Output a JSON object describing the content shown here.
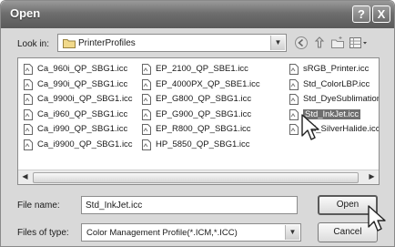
{
  "window": {
    "title": "Open"
  },
  "titlebar_buttons": {
    "help": "?",
    "close": "X"
  },
  "lookin": {
    "label": "Look in:",
    "value": "PrinterProfiles"
  },
  "toolbar": [
    "back-icon",
    "up-folder-icon",
    "new-folder-icon",
    "views-menu-icon"
  ],
  "files": {
    "col1": [
      "Ca_960i_QP_SBG1.icc",
      "Ca_990i_QP_SBG1.icc",
      "Ca_9900i_QP_SBG1.icc",
      "Ca_i960_QP_SBG1.icc",
      "Ca_i990_QP_SBG1.icc",
      "Ca_i9900_QP_SBG1.icc"
    ],
    "col2": [
      "EP_2100_QP_SBE1.icc",
      "EP_4000PX_QP_SBE1.icc",
      "EP_G800_QP_SBG1.icc",
      "EP_G900_QP_SBG1.icc",
      "EP_R800_QP_SBG1.icc",
      "HP_5850_QP_SBG1.icc"
    ],
    "col3": [
      "sRGB_Printer.icc",
      "Std_ColorLBP.icc",
      "Std_DyeSublimation",
      "Std_InkJet.icc",
      "Std_SilverHalide.icc"
    ]
  },
  "selected_file": "Std_InkJet.icc",
  "filename": {
    "label": "File name:",
    "value": "Std_InkJet.icc"
  },
  "filetype": {
    "label": "Files of type:",
    "value": "Color Management Profile(*.ICM,*.ICC)"
  },
  "buttons": {
    "open": "Open",
    "cancel": "Cancel"
  }
}
